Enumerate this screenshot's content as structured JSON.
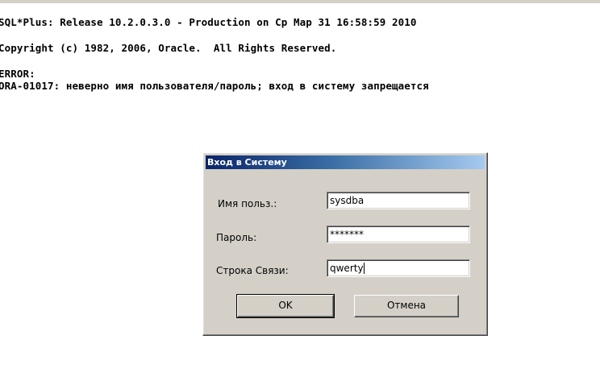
{
  "console": {
    "release_line": "SQL*Plus: Release 10.2.0.3.0 - Production on Ср Мар 31 16:58:59 2010",
    "copyright_line": "Copyright (c) 1982, 2006, Oracle.  All Rights Reserved.",
    "error_label": "ERROR:",
    "error_message": "ORA-01017: неверно имя пользователя/пароль; вход в систему запрещается"
  },
  "dialog": {
    "title": "Вход в Систему",
    "username_label": "Имя польз.:",
    "username_value": "sysdba",
    "password_label": "Пароль:",
    "password_value": "*******",
    "connect_label": "Строка Связи:",
    "connect_value": "qwerty",
    "ok_label": "OK",
    "cancel_label": "Отмена"
  },
  "colors": {
    "dialog_face": "#d4d0c8",
    "titlebar_start": "#0a246a",
    "titlebar_end": "#a6caf0",
    "console_background": "#ffffff",
    "console_text": "#000000"
  }
}
